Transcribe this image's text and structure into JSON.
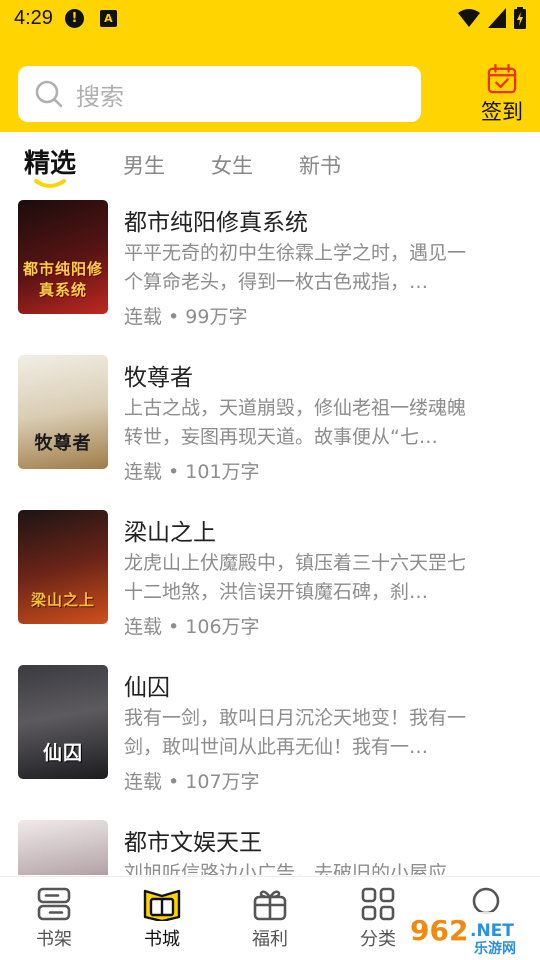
{
  "status_bar": {
    "time": "4:29",
    "icon1": "!",
    "icon2": "A"
  },
  "search": {
    "placeholder": "搜索"
  },
  "signin": {
    "label": "签到"
  },
  "tabs": [
    {
      "label": "精选",
      "active": true
    },
    {
      "label": "男生"
    },
    {
      "label": "女生"
    },
    {
      "label": "新书"
    }
  ],
  "books": [
    {
      "title": "都市纯阳修真系统",
      "desc": "平平无奇的初中生徐霖上学之时，遇见一个算命老头，得到一枚古色戒指，…",
      "meta": "连载 • 99万字",
      "cover_text": "都市纯阳修真系统",
      "cover_colors": [
        "#3a1010",
        "#8a1a1a"
      ]
    },
    {
      "title": "牧尊者",
      "desc": "上古之战，天道崩毁，修仙老祖一缕魂魄转世，妄图再现天道。故事便从“七…",
      "meta": "连载 • 101万字",
      "cover_text": "牧尊者",
      "cover_colors": [
        "#e8e2d6",
        "#b89a6a"
      ]
    },
    {
      "title": "梁山之上",
      "desc": "龙虎山上伏魔殿中，镇压着三十六天罡七十二地煞，洪信误开镇魔石碑，刹…",
      "meta": "连载 • 106万字",
      "cover_text": "梁山之上",
      "cover_colors": [
        "#2a1a1a",
        "#a03018"
      ]
    },
    {
      "title": "仙囚",
      "desc": "我有一剑，敢叫日月沉沦天地变！我有一剑，敢叫世间从此再无仙！我有一…",
      "meta": "连载 • 107万字",
      "cover_text": "仙囚",
      "cover_colors": [
        "#2a2a2e",
        "#6a6a70"
      ]
    },
    {
      "title": "都市文娱天王",
      "desc": "刘旭听信路边小广告，去破旧的小屋应",
      "meta": "",
      "cover_text": "",
      "cover_colors": [
        "#d8d4d4",
        "#8a7a80"
      ]
    }
  ],
  "bottom_nav": [
    {
      "label": "书架",
      "icon": "bookshelf-icon"
    },
    {
      "label": "书城",
      "icon": "bookstore-icon",
      "active": true
    },
    {
      "label": "福利",
      "icon": "gift-icon"
    },
    {
      "label": "分类",
      "icon": "category-icon"
    },
    {
      "label": "",
      "icon": "profile-icon"
    }
  ],
  "watermark": {
    "text1": "962",
    "text2": ".NET",
    "text3": "乐游网"
  },
  "colors": {
    "brand_yellow": "#FFD400",
    "text_gray": "#8d8d8d"
  }
}
